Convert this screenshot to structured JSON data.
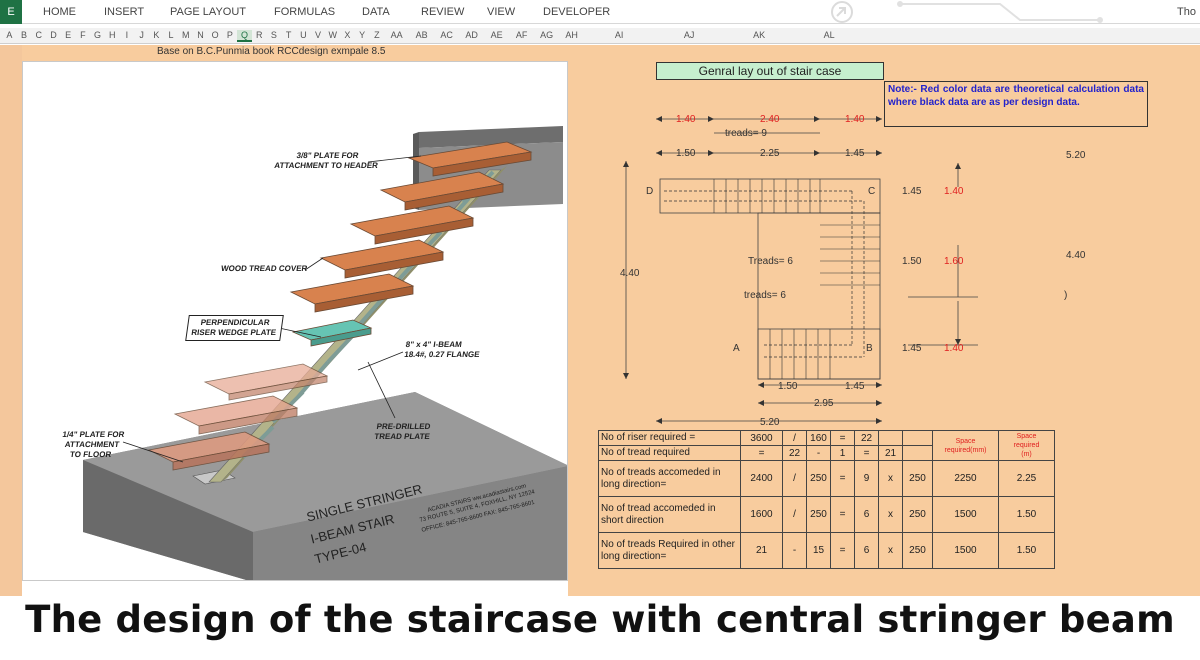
{
  "ribbon": {
    "file_label": "E",
    "tabs": [
      "HOME",
      "INSERT",
      "PAGE LAYOUT",
      "FORMULAS",
      "DATA",
      "REVIEW",
      "VIEW",
      "DEVELOPER"
    ],
    "user": "Tho"
  },
  "columns": [
    "A",
    "B",
    "C",
    "D",
    "E",
    "F",
    "G",
    "H",
    "I",
    "J",
    "K",
    "L",
    "M",
    "N",
    "O",
    "P",
    "Q",
    "R",
    "S",
    "T",
    "U",
    "V",
    "W",
    "X",
    "Y",
    "Z",
    "AA",
    "AB",
    "AC",
    "AD",
    "AE",
    "AF",
    "AG",
    "AH",
    "AI",
    "AJ",
    "AK",
    "AL"
  ],
  "selected_column": "Q",
  "sheet": {
    "base_note": "Base on B.C.Punmia book RCCdesign exmpale 8.5"
  },
  "picture": {
    "label_header_plate": "3/8\" PLATE FOR\nATTACHMENT TO HEADER",
    "label_wood": "WOOD TREAD COVER",
    "label_riser": "PERPENDICULAR\nRISER WEDGE PLATE",
    "label_ibeam": "8\" x 4\" I-BEAM\n18.4#, 0.27 FLANGE",
    "label_predrilled": "PRE-DRILLED\nTREAD PLATE",
    "label_floor_plate": "1/4\" PLATE FOR\nATTACHMENT\nTO FLOOR",
    "base_title_1": "SINGLE STRINGER",
    "base_title_2": "I-BEAM STAIR",
    "base_title_3": "TYPE-04",
    "company_1": "ACADIA STAIRS  ww.acadiastairs.com",
    "company_2": "73 ROUTE 5, SUITE 4, FOXHILL, NY 12524",
    "company_3": "OFFICE: 845-765-8600  FAX: 845-765-8601"
  },
  "layout": {
    "title": "Genral  lay out of stair case",
    "note": "Note:- Red color data are theoretical calculation data where black data are as per design data.",
    "dims": {
      "top_left_red": "1.40",
      "top_mid_red": "2.40",
      "top_right_red": "1.40",
      "treads_top": "treads=  9",
      "black_left": "1.50",
      "black_mid": "2.25",
      "black_right": "1.45",
      "right_total": "5.20",
      "right_mid_total": "4.40",
      "left_height": "4.40",
      "v1_black": "1.45",
      "v1_red": "1.40",
      "v2_black": "1.50",
      "v2_red": "1.60",
      "v3_black": "1.45",
      "v3_red": "1.40",
      "treads_mid": "Treads=  6",
      "treads_low": "treads=  6",
      "bottom_left": "1.50",
      "bottom_right": "1.45",
      "bottom_total": "2.95",
      "overall": "5.20",
      "pt_a": "A",
      "pt_b": "B",
      "pt_c": "C",
      "pt_d": "D",
      "stray": ")"
    }
  },
  "calc_table": {
    "header_space_mm": "Space\nrequired(mm)",
    "header_space_m": "Space\nrequired\n(m)",
    "rows": [
      {
        "desc": "No of riser required =",
        "a": "3600",
        "op1": "/",
        "b": "160",
        "op2": "=",
        "c": "22",
        "d": "",
        "op3": "",
        "e": "",
        "mm": "",
        "m": ""
      },
      {
        "desc": "No of tread required",
        "a": "=",
        "op1": "22",
        "b": "-",
        "op2": "1",
        "c": "=",
        "d": "21",
        "op3": "",
        "e": "",
        "mm": "",
        "m": ""
      },
      {
        "desc": "No of treads accomeded in long direction=",
        "a": "2400",
        "op1": "/",
        "b": "250",
        "op2": "=",
        "c": "9",
        "d": "x",
        "op3": "250",
        "e": "",
        "mm": "2250",
        "m": "2.25"
      },
      {
        "desc": "No of tread accomeded in short direction",
        "a": "1600",
        "op1": "/",
        "b": "250",
        "op2": "=",
        "c": "6",
        "d": "x",
        "op3": "250",
        "e": "",
        "mm": "1500",
        "m": "1.50"
      },
      {
        "desc": "No of treads Required in other long direction=",
        "a": "21",
        "op1": "-",
        "b": "15",
        "op2": "=",
        "c": "6",
        "d": "x",
        "op3": "250",
        "e": "",
        "mm": "1500",
        "m": "1.50"
      }
    ]
  },
  "caption": "The design of the staircase with central stringer beam",
  "colors": {
    "sheet_bg": "#f8cc9e",
    "title_bg": "#c6efce",
    "excel_green": "#1f7244",
    "note_blue": "#2222cc",
    "theory_red": "#e02020"
  }
}
